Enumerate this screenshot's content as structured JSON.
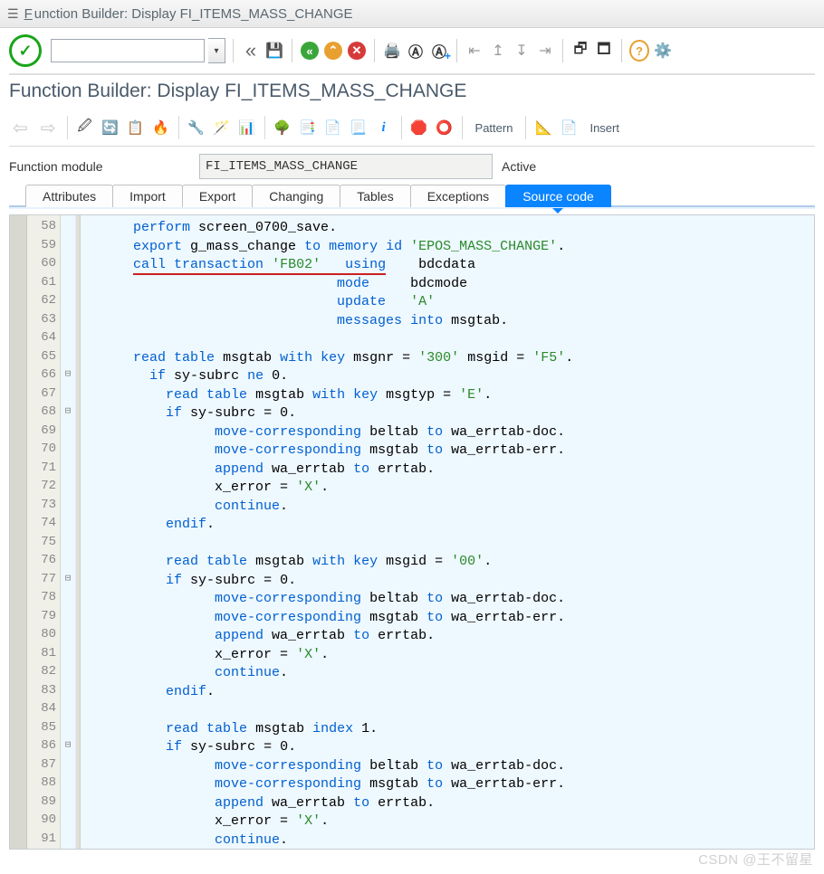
{
  "window": {
    "title_prefix": "F",
    "title_rest": "unction Builder: Display FI_ITEMS_MASS_CHANGE"
  },
  "heading": "Function Builder: Display FI_ITEMS_MASS_CHANGE",
  "top_toolbar": {
    "cmd_value": "",
    "rewind_glyph": "«",
    "save_glyph": "💾"
  },
  "sub_toolbar": {
    "pattern_label": "Pattern",
    "insert_label": "Insert"
  },
  "fm": {
    "label": "Function module",
    "value": "FI_ITEMS_MASS_CHANGE",
    "status": "Active"
  },
  "tabs": [
    {
      "label": "Attributes",
      "active": false
    },
    {
      "label": "Import",
      "active": false
    },
    {
      "label": "Export",
      "active": false
    },
    {
      "label": "Changing",
      "active": false
    },
    {
      "label": "Tables",
      "active": false
    },
    {
      "label": "Exceptions",
      "active": false
    },
    {
      "label": "Source code",
      "active": true
    }
  ],
  "code": {
    "first_line": 58,
    "lines": [
      {
        "n": 58,
        "fold": "",
        "html": "      <span class='kw'>perform</span> screen_0700_save<span class='punct'>.</span>"
      },
      {
        "n": 59,
        "fold": "",
        "html": "      <span class='kw'>export</span> g_mass_change <span class='kw'>to</span> <span class='kw'>memory</span> <span class='kw'>id</span> <span class='str'>'EPOS_MASS_CHANGE'</span><span class='punct'>.</span>"
      },
      {
        "n": 60,
        "fold": "",
        "html": "      <span class='underline-ann'><span class='kw'>call</span> <span class='kw'>transaction</span> <span class='str'>'FB02'</span>   <span class='kw'>using</span></span>    bdcdata"
      },
      {
        "n": 61,
        "fold": "",
        "html": "                               <span class='kw'>mode</span>     bdcmode"
      },
      {
        "n": 62,
        "fold": "",
        "html": "                               <span class='kw'>update</span>   <span class='str'>'A'</span>"
      },
      {
        "n": 63,
        "fold": "",
        "html": "                               <span class='kw'>messages</span> <span class='kw'>into</span> msgtab<span class='punct'>.</span>"
      },
      {
        "n": 64,
        "fold": "",
        "html": ""
      },
      {
        "n": 65,
        "fold": "",
        "html": "      <span class='kw'>read</span> <span class='kw'>table</span> msgtab <span class='kw'>with</span> <span class='kw'>key</span> msgnr <span class='punct'>=</span> <span class='str'>'300'</span> msgid <span class='punct'>=</span> <span class='str'>'F5'</span><span class='punct'>.</span>"
      },
      {
        "n": 66,
        "fold": "⊟",
        "html": "        <span class='kw'>if</span> sy<span class='punct'>-</span>subrc <span class='kw'>ne</span> <span class='num'>0</span><span class='punct'>.</span>"
      },
      {
        "n": 67,
        "fold": "",
        "html": "          <span class='kw'>read</span> <span class='kw'>table</span> msgtab <span class='kw'>with</span> <span class='kw'>key</span> msgtyp <span class='punct'>=</span> <span class='str'>'E'</span><span class='punct'>.</span>"
      },
      {
        "n": 68,
        "fold": "⊟",
        "html": "          <span class='kw'>if</span> sy<span class='punct'>-</span>subrc <span class='punct'>=</span> <span class='num'>0</span><span class='punct'>.</span>"
      },
      {
        "n": 69,
        "fold": "",
        "html": "                <span class='kw'>move-corresponding</span> beltab <span class='kw'>to</span> wa_errtab<span class='punct'>-</span>doc<span class='punct'>.</span>"
      },
      {
        "n": 70,
        "fold": "",
        "html": "                <span class='kw'>move-corresponding</span> msgtab <span class='kw'>to</span> wa_errtab<span class='punct'>-</span>err<span class='punct'>.</span>"
      },
      {
        "n": 71,
        "fold": "",
        "html": "                <span class='kw'>append</span> wa_errtab <span class='kw'>to</span> errtab<span class='punct'>.</span>"
      },
      {
        "n": 72,
        "fold": "",
        "html": "                x_error <span class='punct'>=</span> <span class='str'>'X'</span><span class='punct'>.</span>"
      },
      {
        "n": 73,
        "fold": "",
        "html": "                <span class='kw'>continue</span><span class='punct'>.</span>"
      },
      {
        "n": 74,
        "fold": "",
        "html": "          <span class='kw'>endif</span><span class='punct'>.</span>"
      },
      {
        "n": 75,
        "fold": "",
        "html": ""
      },
      {
        "n": 76,
        "fold": "",
        "html": "          <span class='kw'>read</span> <span class='kw'>table</span> msgtab <span class='kw'>with</span> <span class='kw'>key</span> msgid <span class='punct'>=</span> <span class='str'>'00'</span><span class='punct'>.</span>"
      },
      {
        "n": 77,
        "fold": "⊟",
        "html": "          <span class='kw'>if</span> sy<span class='punct'>-</span>subrc <span class='punct'>=</span> <span class='num'>0</span><span class='punct'>.</span>"
      },
      {
        "n": 78,
        "fold": "",
        "html": "                <span class='kw'>move-corresponding</span> beltab <span class='kw'>to</span> wa_errtab<span class='punct'>-</span>doc<span class='punct'>.</span>"
      },
      {
        "n": 79,
        "fold": "",
        "html": "                <span class='kw'>move-corresponding</span> msgtab <span class='kw'>to</span> wa_errtab<span class='punct'>-</span>err<span class='punct'>.</span>"
      },
      {
        "n": 80,
        "fold": "",
        "html": "                <span class='kw'>append</span> wa_errtab <span class='kw'>to</span> errtab<span class='punct'>.</span>"
      },
      {
        "n": 81,
        "fold": "",
        "html": "                x_error <span class='punct'>=</span> <span class='str'>'X'</span><span class='punct'>.</span>"
      },
      {
        "n": 82,
        "fold": "",
        "html": "                <span class='kw'>continue</span><span class='punct'>.</span>"
      },
      {
        "n": 83,
        "fold": "",
        "html": "          <span class='kw'>endif</span><span class='punct'>.</span>"
      },
      {
        "n": 84,
        "fold": "",
        "html": ""
      },
      {
        "n": 85,
        "fold": "",
        "html": "          <span class='kw'>read</span> <span class='kw'>table</span> msgtab <span class='kw'>index</span> <span class='num'>1</span><span class='punct'>.</span>"
      },
      {
        "n": 86,
        "fold": "⊟",
        "html": "          <span class='kw'>if</span> sy<span class='punct'>-</span>subrc <span class='punct'>=</span> <span class='num'>0</span><span class='punct'>.</span>"
      },
      {
        "n": 87,
        "fold": "",
        "html": "                <span class='kw'>move-corresponding</span> beltab <span class='kw'>to</span> wa_errtab<span class='punct'>-</span>doc<span class='punct'>.</span>"
      },
      {
        "n": 88,
        "fold": "",
        "html": "                <span class='kw'>move-corresponding</span> msgtab <span class='kw'>to</span> wa_errtab<span class='punct'>-</span>err<span class='punct'>.</span>"
      },
      {
        "n": 89,
        "fold": "",
        "html": "                <span class='kw'>append</span> wa_errtab <span class='kw'>to</span> errtab<span class='punct'>.</span>"
      },
      {
        "n": 90,
        "fold": "",
        "html": "                x_error <span class='punct'>=</span> <span class='str'>'X'</span><span class='punct'>.</span>"
      },
      {
        "n": 91,
        "fold": "",
        "html": "                <span class='kw'>continue</span><span class='punct'>.</span>"
      }
    ]
  },
  "watermark": "CSDN @王不留星"
}
